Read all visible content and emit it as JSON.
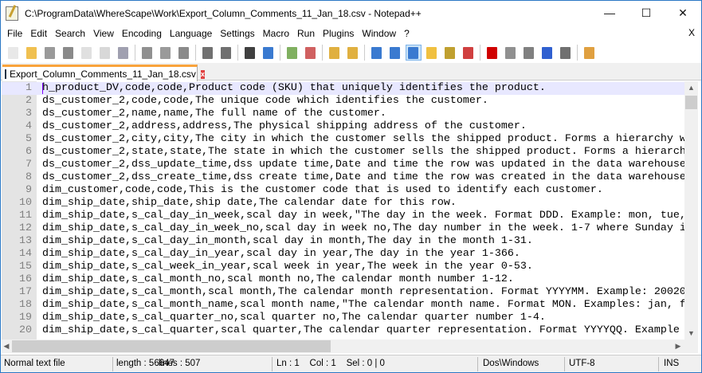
{
  "window": {
    "title": "C:\\ProgramData\\WhereScape\\Work\\Export_Column_Comments_11_Jan_18.csv - Notepad++",
    "minimize": "—",
    "maximize": "☐",
    "close": "✕"
  },
  "menu": {
    "items": [
      "File",
      "Edit",
      "Search",
      "View",
      "Encoding",
      "Language",
      "Settings",
      "Macro",
      "Run",
      "Plugins",
      "Window",
      "?"
    ],
    "close": "X"
  },
  "toolbar": [
    {
      "name": "new-file-icon",
      "color": "#e8e8e8"
    },
    {
      "name": "open-file-icon",
      "color": "#f0c050"
    },
    {
      "name": "save-icon",
      "color": "#9a9a9a"
    },
    {
      "name": "save-all-icon",
      "color": "#8a8a8a"
    },
    {
      "name": "close-icon",
      "color": "#e0e0e0"
    },
    {
      "name": "close-all-icon",
      "color": "#d8d8d8"
    },
    {
      "name": "print-icon",
      "color": "#a0a0b0"
    },
    "sep",
    {
      "name": "cut-icon",
      "color": "#909090"
    },
    {
      "name": "copy-icon",
      "color": "#9a9a9a"
    },
    {
      "name": "paste-icon",
      "color": "#8a8a8a"
    },
    "sep",
    {
      "name": "undo-icon",
      "color": "#707070"
    },
    {
      "name": "redo-icon",
      "color": "#707070"
    },
    "sep",
    {
      "name": "find-icon",
      "color": "#404040"
    },
    {
      "name": "replace-icon",
      "color": "#3a7ad0"
    },
    "sep",
    {
      "name": "zoom-in-icon",
      "color": "#80b060"
    },
    {
      "name": "zoom-out-icon",
      "color": "#d06060"
    },
    "sep",
    {
      "name": "sync-vertical-icon",
      "color": "#e0b040"
    },
    {
      "name": "sync-horizontal-icon",
      "color": "#e0b040"
    },
    "sep",
    {
      "name": "word-wrap-icon",
      "color": "#3a7ad0"
    },
    {
      "name": "show-all-chars-icon",
      "color": "#3a7ad0"
    },
    {
      "name": "indent-guide-icon",
      "color": "#3a7ad0",
      "active": true
    },
    {
      "name": "doc-map-icon",
      "color": "#f0c040"
    },
    {
      "name": "function-list-icon",
      "color": "#c0a030"
    },
    {
      "name": "folder-as-workspace-icon",
      "color": "#d04040"
    },
    "sep",
    {
      "name": "record-macro-icon",
      "color": "#d00000"
    },
    {
      "name": "stop-record-icon",
      "color": "#909090"
    },
    {
      "name": "play-macro-icon",
      "color": "#808080"
    },
    {
      "name": "play-multiple-icon",
      "color": "#3060d0"
    },
    {
      "name": "save-macro-icon",
      "color": "#707070"
    },
    "sep",
    {
      "name": "launch-icon",
      "color": "#e0a040"
    }
  ],
  "tab": {
    "label": "Export_Column_Comments_11_Jan_18.csv",
    "close": "x"
  },
  "editor": {
    "lines": [
      "h_product_DV,code,code,Product code (SKU) that uniquely identifies the product.",
      "ds_customer_2,code,code,The unique code which identifies the customer.",
      "ds_customer_2,name,name,The full name of the customer.",
      "ds_customer_2,address,address,The physical shipping address of the customer.",
      "ds_customer_2,city,city,The city in which the customer sells the shipped product. Forms a hierarchy w",
      "ds_customer_2,state,state,The state in which the customer sells the shipped product. Forms a hierarch",
      "ds_customer_2,dss_update_time,dss update time,Date and time the row was updated in the data warehouse",
      "ds_customer_2,dss_create_time,dss create time,Date and time the row was created in the data warehouse",
      "dim_customer,code,code,This is the customer code that is used to identify each customer.",
      "dim_ship_date,ship_date,ship date,The calendar date for this row.",
      "dim_ship_date,s_cal_day_in_week,scal day in week,\"The day in the week. Format DDD. Example: mon, tue,",
      "dim_ship_date,s_cal_day_in_week_no,scal day in week no,The day number in the week. 1-7 where Sunday i",
      "dim_ship_date,s_cal_day_in_month,scal day in month,The day in the month 1-31.",
      "dim_ship_date,s_cal_day_in_year,scal day in year,The day in the year 1-366.",
      "dim_ship_date,s_cal_week_in_year,scal week in year,The week in the year 0-53.",
      "dim_ship_date,s_cal_month_no,scal month no,The calendar month number 1-12.",
      "dim_ship_date,s_cal_month,scal month,The calendar month representation. Format YYYYMM. Example: 20020",
      "dim_ship_date,s_cal_month_name,scal month name,\"The calendar month name. Format MON. Examples: jan, f",
      "dim_ship_date,s_cal_quarter_no,scal quarter no,The calendar quarter number 1-4.",
      "dim_ship_date,s_cal_quarter,scal quarter,The calendar quarter representation. Format YYYYQQ. Example "
    ],
    "first_line_number": 1
  },
  "status": {
    "file_type": "Normal text file",
    "length": "length : 56647",
    "lines": "lines : 507",
    "position": "Ln : 1    Col : 1    Sel : 0 | 0",
    "eol": "Dos\\Windows",
    "encoding": "UTF-8",
    "mode": "INS"
  }
}
